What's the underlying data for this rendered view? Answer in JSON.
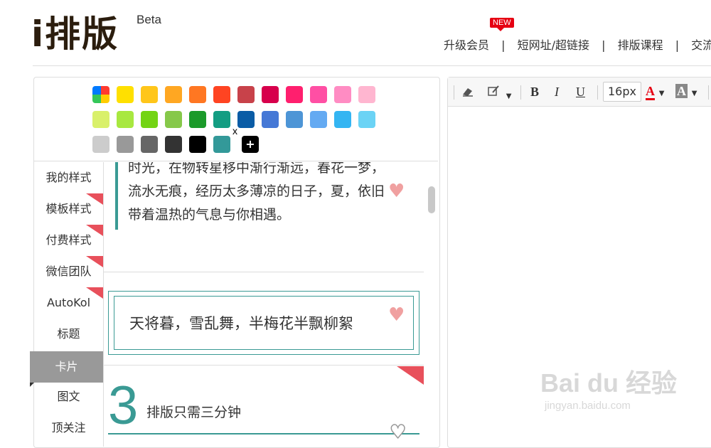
{
  "logo": {
    "text": "i排版",
    "badge": "Beta"
  },
  "topnav": {
    "new_badge": "NEW",
    "items": [
      "升级会员",
      "短网址/超链接",
      "排版课程",
      "交流/反"
    ],
    "separator": "|"
  },
  "palette": {
    "colors_row1": [
      "#ffe000",
      "#ffc61a",
      "#ffa722",
      "#ff7722",
      "#ff4422",
      "#c8424a",
      "#d7004c",
      "#ff1f6e",
      "#ff4fa4",
      "#ff8cc3",
      "#ffb6d0"
    ],
    "colors_row2": [
      "#d9f06a",
      "#a8e840",
      "#73d414",
      "#86c84a",
      "#1b9a2a",
      "#139d82",
      "#0a5ca6",
      "#4578d6",
      "#4d95d6",
      "#64aaf2",
      "#34b5f2",
      "#6bd3f5"
    ],
    "colors_row3": [
      "#cccccc",
      "#999999",
      "#666666",
      "#333333",
      "#000000",
      "#339999"
    ],
    "add_label": "+",
    "remove_label": "x"
  },
  "sidebar": {
    "items": [
      "我的样式",
      "模板样式",
      "付费样式",
      "微信团队",
      "AutoKol",
      "标题",
      "卡片",
      "图文",
      "顶关注"
    ],
    "active": "卡片"
  },
  "cards": {
    "card1_text": "时光，在物转星移中渐行渐远，春花一梦，流水无痕，经历太多薄凉的日子，夏，依旧带着温热的气息与你相遇。",
    "card2_text": "天将暮，雪乱舞，半梅花半飘柳絮",
    "card3_number": "3",
    "card3_text": "排版只需三分钟"
  },
  "toolbar": {
    "font_size": "16px",
    "bold": "B",
    "italic": "I",
    "underline": "U",
    "font_color_label": "A",
    "bg_color_label": "A",
    "font_color": "#e60012"
  },
  "watermark": {
    "main": "Bai du 经验",
    "sub": "jingyan.baidu.com"
  }
}
